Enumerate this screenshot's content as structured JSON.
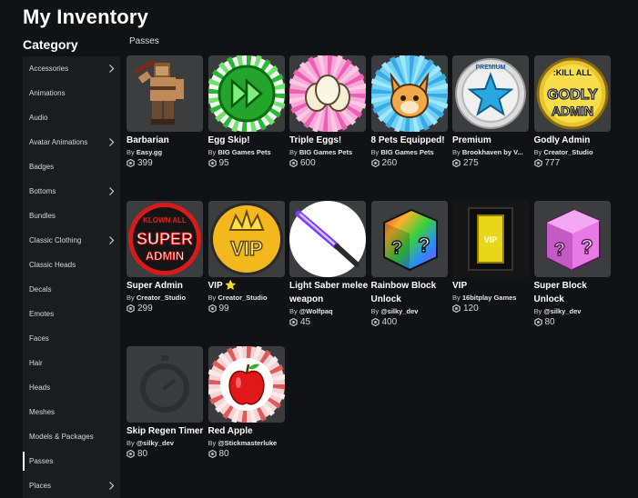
{
  "page": {
    "title": "My Inventory",
    "category_title": "Category",
    "section_title": "Passes"
  },
  "sidebar": {
    "items": [
      {
        "label": "Accessories",
        "chevron": true
      },
      {
        "label": "Animations",
        "chevron": false
      },
      {
        "label": "Audio",
        "chevron": false
      },
      {
        "label": "Avatar Animations",
        "chevron": true
      },
      {
        "label": "Badges",
        "chevron": false
      },
      {
        "label": "Bottoms",
        "chevron": true
      },
      {
        "label": "Bundles",
        "chevron": false
      },
      {
        "label": "Classic Clothing",
        "chevron": true
      },
      {
        "label": "Classic Heads",
        "chevron": false
      },
      {
        "label": "Decals",
        "chevron": false
      },
      {
        "label": "Emotes",
        "chevron": false
      },
      {
        "label": "Faces",
        "chevron": false
      },
      {
        "label": "Hair",
        "chevron": false
      },
      {
        "label": "Heads",
        "chevron": false
      },
      {
        "label": "Meshes",
        "chevron": false
      },
      {
        "label": "Models & Packages",
        "chevron": false
      },
      {
        "label": "Passes",
        "chevron": false,
        "active": true
      },
      {
        "label": "Places",
        "chevron": true
      }
    ]
  },
  "items": [
    {
      "name": "Barbarian",
      "by_prefix": "By",
      "creator": "Easy.gg",
      "price": "399",
      "icon": "barbarian"
    },
    {
      "name": "Egg Skip!",
      "by_prefix": "By",
      "creator": "BIG Games Pets",
      "price": "95",
      "icon": "egg-skip"
    },
    {
      "name": "Triple Eggs!",
      "by_prefix": "By",
      "creator": "BIG Games Pets",
      "price": "600",
      "icon": "triple-eggs"
    },
    {
      "name": "8 Pets Equipped!",
      "by_prefix": "By",
      "creator": "BIG Games Pets",
      "price": "260",
      "icon": "pets"
    },
    {
      "name": "Premium",
      "by_prefix": "By",
      "creator": "Brookhaven by V...",
      "price": "275",
      "icon": "premium-star",
      "badge_text": "PREMIUM"
    },
    {
      "name": "Godly Admin",
      "by_prefix": "By",
      "creator": "Creator_Studio",
      "price": "777",
      "icon": "godly-admin",
      "badge_lines": [
        ":KILL ALL",
        "GODLY",
        "ADMIN"
      ]
    },
    {
      "name": "Super Admin",
      "by_prefix": "By",
      "creator": "Creator_Studio",
      "price": "299",
      "icon": "super-admin",
      "badge_lines": [
        "KLOWN ALL",
        "SUPER",
        "ADMIN"
      ]
    },
    {
      "name": "VIP ⭐",
      "by_prefix": "By",
      "creator": "Creator_Studio",
      "price": "99",
      "icon": "vip-crown",
      "badge_text": "VIP"
    },
    {
      "name": "Light Saber melee weapon",
      "by_prefix": "By",
      "creator": "@Wolfpaq",
      "price": "45",
      "icon": "light-saber"
    },
    {
      "name": "Rainbow Block Unlock",
      "by_prefix": "By",
      "creator": "@silky_dev",
      "price": "400",
      "icon": "rainbow-block"
    },
    {
      "name": "VIP",
      "by_prefix": "By",
      "creator": "16bitplay Games",
      "price": "120",
      "icon": "vip-door",
      "badge_text": "VIP"
    },
    {
      "name": "Super Block Unlock",
      "by_prefix": "By",
      "creator": "@silky_dev",
      "price": "80",
      "icon": "super-block"
    },
    {
      "name": "Skip Regen Timer",
      "by_prefix": "By",
      "creator": "@silky_dev",
      "price": "80",
      "icon": "stopwatch"
    },
    {
      "name": "Red Apple",
      "by_prefix": "By",
      "creator": "@Stickmasterluke",
      "price": "80",
      "icon": "red-apple"
    }
  ],
  "colors": {
    "background": "#111216",
    "sidebar": "#1b1c20",
    "card": "#393b3d",
    "text_muted": "#c8c8ca"
  }
}
